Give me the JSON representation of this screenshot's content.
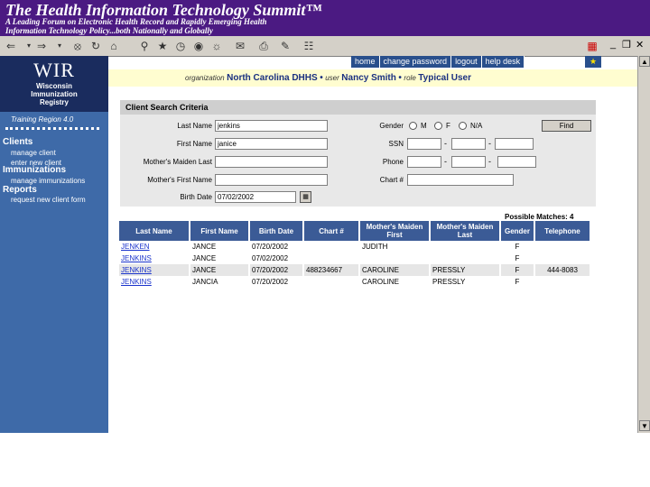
{
  "banner": {
    "title": "The Health Information Technology Summit™",
    "subtitle_1": "A Leading Forum on Electronic Health Record and Rapidly Emerging Health",
    "subtitle_2": "Information Technology Policy...both Nationally and Globally"
  },
  "toolbar": {
    "icons": [
      "back-icon",
      "forward-icon",
      "stop-icon",
      "refresh-icon",
      "home-icon",
      "search-icon",
      "favorites-icon",
      "history-icon",
      "mail-icon",
      "print-icon",
      "edit-icon",
      "discuss-icon"
    ],
    "window_controls": [
      "_",
      "❒",
      "✕"
    ]
  },
  "logo": {
    "abbr": "WIR",
    "line1": "Wisconsin",
    "line2": "Immunization",
    "line3": "Registry"
  },
  "sidebar": {
    "region": "Training Region 4.0",
    "clients_header": "Clients",
    "manage_client": "manage client",
    "enter_new_client": "enter new client",
    "immunizations_header": "Immunizations",
    "manage_immunizations": "manage immunizations",
    "reports_header": "Reports",
    "request_new_client_form": "request new client form"
  },
  "topnav": {
    "home": "home",
    "change_password": "change password",
    "logout": "logout",
    "help_desk": "help desk"
  },
  "userbar": {
    "org_label": "organization",
    "org_value": "North Carolina DHHS",
    "user_label": "user",
    "user_value": "Nancy Smith",
    "role_label": "role",
    "role_value": "Typical User",
    "sep": "•"
  },
  "criteria": {
    "title": "Client Search Criteria",
    "last_name_label": "Last Name",
    "last_name_value": "jenkins",
    "first_name_label": "First Name",
    "first_name_value": "janice",
    "mothers_maiden_last_label": "Mother's Maiden Last",
    "mothers_first_label": "Mother's First Name",
    "birth_date_label": "Birth Date",
    "birth_date_value": "07/02/2002",
    "gender_label": "Gender",
    "gender_options": [
      "M",
      "F",
      "N/A"
    ],
    "ssn_label": "SSN",
    "phone_label": "Phone",
    "chart_label": "Chart #",
    "find_button": "Find",
    "dash": "-"
  },
  "results": {
    "matches_label": "Possible Matches: 4",
    "columns": [
      "Last Name",
      "First Name",
      "Birth Date",
      "Chart #",
      "Mother's Maiden First",
      "Mother's Maiden Last",
      "Gender",
      "Telephone"
    ],
    "rows": [
      [
        "JENKEN",
        "JANCE",
        "07/20/2002",
        "",
        "JUDITH",
        "",
        "F",
        ""
      ],
      [
        "JENKINS",
        "JANCE",
        "07/02/2002",
        "",
        "",
        "",
        "F",
        ""
      ],
      [
        "JENKINS",
        "JANCE",
        "07/20/2002",
        "488234667",
        "CAROLINE",
        "PRESSLY",
        "F",
        "444-8083"
      ],
      [
        "JENKINS",
        "JANCIA",
        "07/20/2002",
        "",
        "CAROLINE",
        "PRESSLY",
        "F",
        ""
      ]
    ]
  }
}
